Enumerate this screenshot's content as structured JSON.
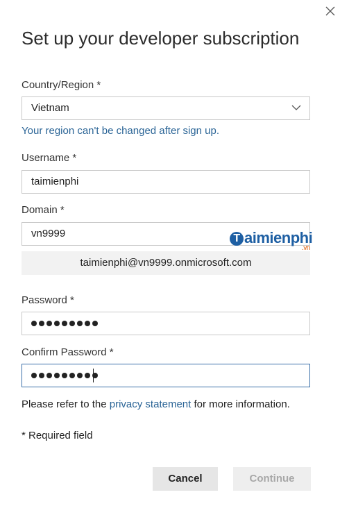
{
  "dialog": {
    "title": "Set up your developer subscription",
    "close_icon": "close-icon"
  },
  "country": {
    "label": "Country/Region *",
    "value": "Vietnam",
    "note": "Your region can't be changed after sign up."
  },
  "username": {
    "label": "Username *",
    "value": "taimienphi"
  },
  "domain": {
    "label": "Domain *",
    "value": "vn9999",
    "preview": "taimienphi@vn9999.onmicrosoft.com"
  },
  "password": {
    "label": "Password *",
    "masked_length": 9
  },
  "confirm_password": {
    "label": "Confirm Password *",
    "masked_length": 9
  },
  "footer": {
    "privacy_prefix": "Please refer to the ",
    "privacy_link": "privacy statement",
    "privacy_suffix": " for more information.",
    "required_note": "* Required field"
  },
  "buttons": {
    "cancel": "Cancel",
    "continue": "Continue"
  },
  "watermark": {
    "initial": "T",
    "text": "aimienphi",
    "suffix": ".vn"
  },
  "colors": {
    "link": "#2a6496",
    "focus_border": "#3a6fa8",
    "watermark": "#1e5fa3"
  }
}
